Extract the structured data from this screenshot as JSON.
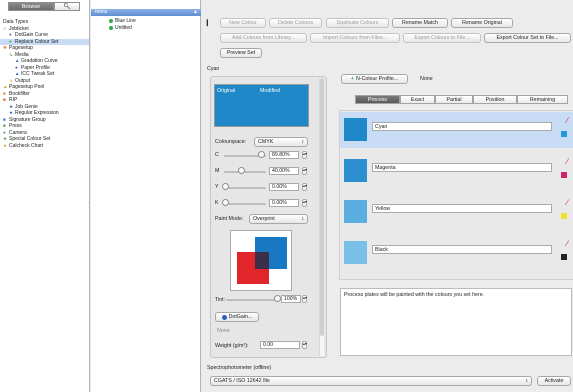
{
  "left": {
    "segments": [
      "Browse",
      "search-icon"
    ],
    "tree": [
      {
        "label": "Data Types",
        "indent": 0,
        "icon": ""
      },
      {
        "label": "Jobticket",
        "indent": 0,
        "icon": "checkmark-icon",
        "color": "#3a6fd0"
      },
      {
        "label": "DotGain Curve",
        "indent": 1,
        "icon": "circle-icon",
        "color": "#3a6fd0"
      },
      {
        "label": "Replace Colour Set",
        "indent": 1,
        "icon": "circle-icon",
        "color": "#3aa84a",
        "selected": true
      },
      {
        "label": "Pagesetup",
        "indent": 0,
        "icon": "gear-icon",
        "color": "#e08a2a"
      },
      {
        "label": "Media",
        "indent": 1,
        "icon": "corner-icon",
        "color": "#3a9a3a"
      },
      {
        "label": "Gradation Curve",
        "indent": 2,
        "icon": "triangle-icon",
        "color": "#2a5fbf"
      },
      {
        "label": "Paper Profile",
        "indent": 2,
        "icon": "circle-icon",
        "color": "#2a5fbf"
      },
      {
        "label": "ICC Tweak Set",
        "indent": 2,
        "icon": "triangle-icon",
        "color": "#2a5fbf"
      },
      {
        "label": "Output",
        "indent": 1,
        "icon": "corner-icon",
        "color": "#e0a02a"
      },
      {
        "label": "Pagesetup Pool",
        "indent": 0,
        "icon": "triangle-icon",
        "color": "#e0a02a"
      },
      {
        "label": "Bookfilter",
        "indent": 0,
        "icon": "square-icon",
        "color": "#e08a2a"
      },
      {
        "label": "RIP",
        "indent": 0,
        "icon": "square-icon",
        "color": "#e05a2a"
      },
      {
        "label": "Job Genie",
        "indent": 1,
        "icon": "star-icon",
        "color": "#2a5fbf"
      },
      {
        "label": "Regular Expression",
        "indent": 1,
        "icon": "star-icon",
        "color": "#2a5fbf"
      },
      {
        "label": "Signature Group",
        "indent": 0,
        "icon": "square-icon",
        "color": "#3a6fd0"
      },
      {
        "label": "Press",
        "indent": 0,
        "icon": "square-icon",
        "color": "#3aa84a"
      },
      {
        "label": "Camera",
        "indent": 0,
        "icon": "circle-icon",
        "color": "#3aa84a"
      },
      {
        "label": "Special Colour Set",
        "indent": 0,
        "icon": "star-icon",
        "color": "#3a9a3a"
      },
      {
        "label": "Calcheck Chart",
        "indent": 0,
        "icon": "star-icon",
        "color": "#e0a02a"
      }
    ]
  },
  "items": {
    "header": "Items",
    "list": [
      {
        "label": "Blue Line",
        "color": "#3aa84a"
      },
      {
        "label": "Untitled",
        "color": "#3aa84a"
      }
    ]
  },
  "toolbar": {
    "row1": [
      "New Colour",
      "Delete Colours",
      "Duplicate Colours",
      "Rename Match",
      "Rename Original"
    ],
    "row2": [
      "Add Colours from Library...",
      "Import Colours from Files...",
      "Export Colours to File...",
      "Export Colour Set to File..."
    ],
    "preview": "Preview Set"
  },
  "cyan_section": {
    "label": "Cyan",
    "original_label": "Original",
    "modified_label": "Modified",
    "original_color": "#1e88c8",
    "colourspace_label": "Colourspace:",
    "colourspace_value": "CMYK",
    "channels": [
      {
        "name": "C",
        "value": "89.80%",
        "level": 0.898
      },
      {
        "name": "M",
        "value": "40.00%",
        "level": 0.4
      },
      {
        "name": "Y",
        "value": "0.00%",
        "level": 0
      },
      {
        "name": "K",
        "value": "0.00%",
        "level": 0
      }
    ],
    "paint_mode_label": "Paint Mode:",
    "paint_mode_value": "Overprint",
    "tint_label": "Tint:",
    "tint_value": "100%",
    "tint_level": 1.0,
    "dotgain_button": "DotGain...",
    "dotgain_value": "None",
    "weight_label": "Weight (g/m²):",
    "weight_value": "0.00"
  },
  "plates": {
    "ncolour_button": "N-Colour Profile...",
    "ncolour_value": "None",
    "tabs": [
      "Process",
      "Exact",
      "Partial",
      "Position",
      "Remaining"
    ],
    "active_tab": 0,
    "rows": [
      {
        "name": "Cyan",
        "color": "#1e88c8",
        "mini": "#1e9ad8",
        "selected": true
      },
      {
        "name": "Magenta",
        "color": "#2b8fd0",
        "mini": "#d0246a"
      },
      {
        "name": "Yellow",
        "color": "#5aaee0",
        "mini": "#f2e030"
      },
      {
        "name": "Black",
        "color": "#7abfe8",
        "mini": "#222222"
      }
    ],
    "note": "Process plates will be painted with the colours you set here."
  },
  "spectro": {
    "label": "Spectrophotometer (offline)",
    "select_value": "CGATS / ISO 12642 file",
    "activate": "Activate"
  },
  "colors": {
    "selection": "#c9dcf5",
    "accent": "#3d7ad6"
  }
}
